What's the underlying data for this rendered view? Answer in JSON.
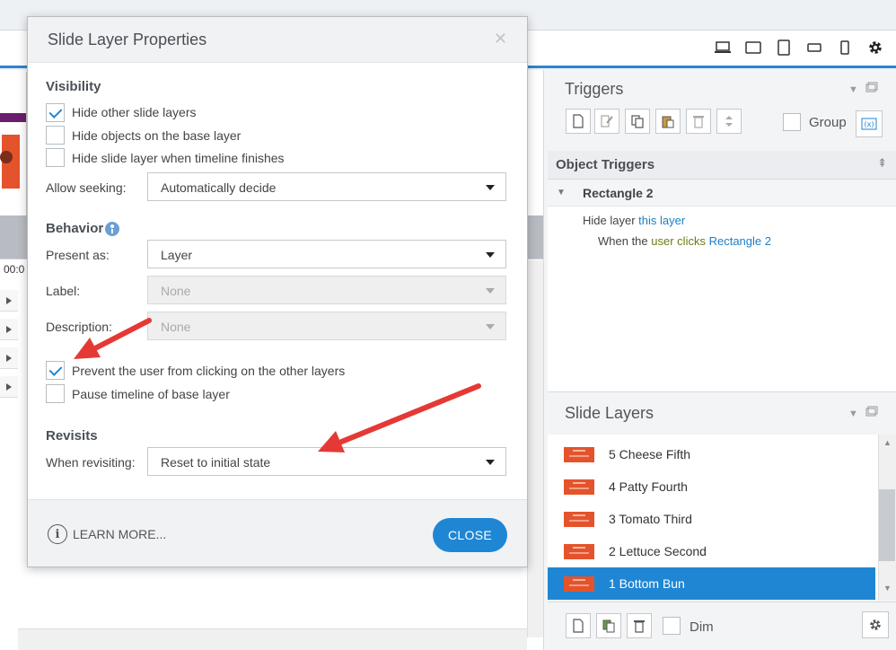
{
  "dialog": {
    "title": "Slide Layer Properties",
    "visibility": {
      "heading": "Visibility",
      "hide_other_layers": {
        "label": "Hide other slide layers",
        "checked": true
      },
      "hide_base_objects": {
        "label": "Hide objects on the base layer",
        "checked": false
      },
      "hide_when_finished": {
        "label": "Hide slide layer when timeline finishes",
        "checked": false
      },
      "allow_seeking_label": "Allow seeking:",
      "allow_seeking_value": "Automatically decide"
    },
    "behavior": {
      "heading": "Behavior",
      "present_as_label": "Present as:",
      "present_as_value": "Layer",
      "label_label": "Label:",
      "label_value": "None",
      "description_label": "Description:",
      "description_value": "None",
      "prevent_clicking": {
        "label": "Prevent the user from clicking on the other layers",
        "checked": true
      },
      "pause_timeline": {
        "label": "Pause timeline of base layer",
        "checked": false
      }
    },
    "revisits": {
      "heading": "Revisits",
      "when_revisiting_label": "When revisiting:",
      "when_revisiting_value": "Reset to initial state"
    },
    "footer": {
      "learn_more": "LEARN MORE...",
      "close": "CLOSE"
    }
  },
  "triggers_panel": {
    "title": "Triggers",
    "group_label": "Group",
    "object_triggers_heading": "Object Triggers",
    "object_name": "Rectangle 2",
    "action_prefix": "Hide layer",
    "action_target": "this layer",
    "condition_prefix": "When the",
    "condition_actor": "user clicks",
    "condition_object": "Rectangle 2"
  },
  "slide_layers_panel": {
    "title": "Slide Layers",
    "dim_label": "Dim",
    "layers": [
      {
        "name": "5 Cheese Fifth",
        "selected": false
      },
      {
        "name": "4 Patty Fourth",
        "selected": false
      },
      {
        "name": "3 Tomato Third",
        "selected": false
      },
      {
        "name": "2 Lettuce Second",
        "selected": false
      },
      {
        "name": "1 Bottom Bun",
        "selected": true
      }
    ]
  },
  "timeline": {
    "time_label": "00:0"
  },
  "colors": {
    "accent": "#1f86d4",
    "annotation_arrow": "#e53935",
    "link": "#1c7fc6"
  }
}
